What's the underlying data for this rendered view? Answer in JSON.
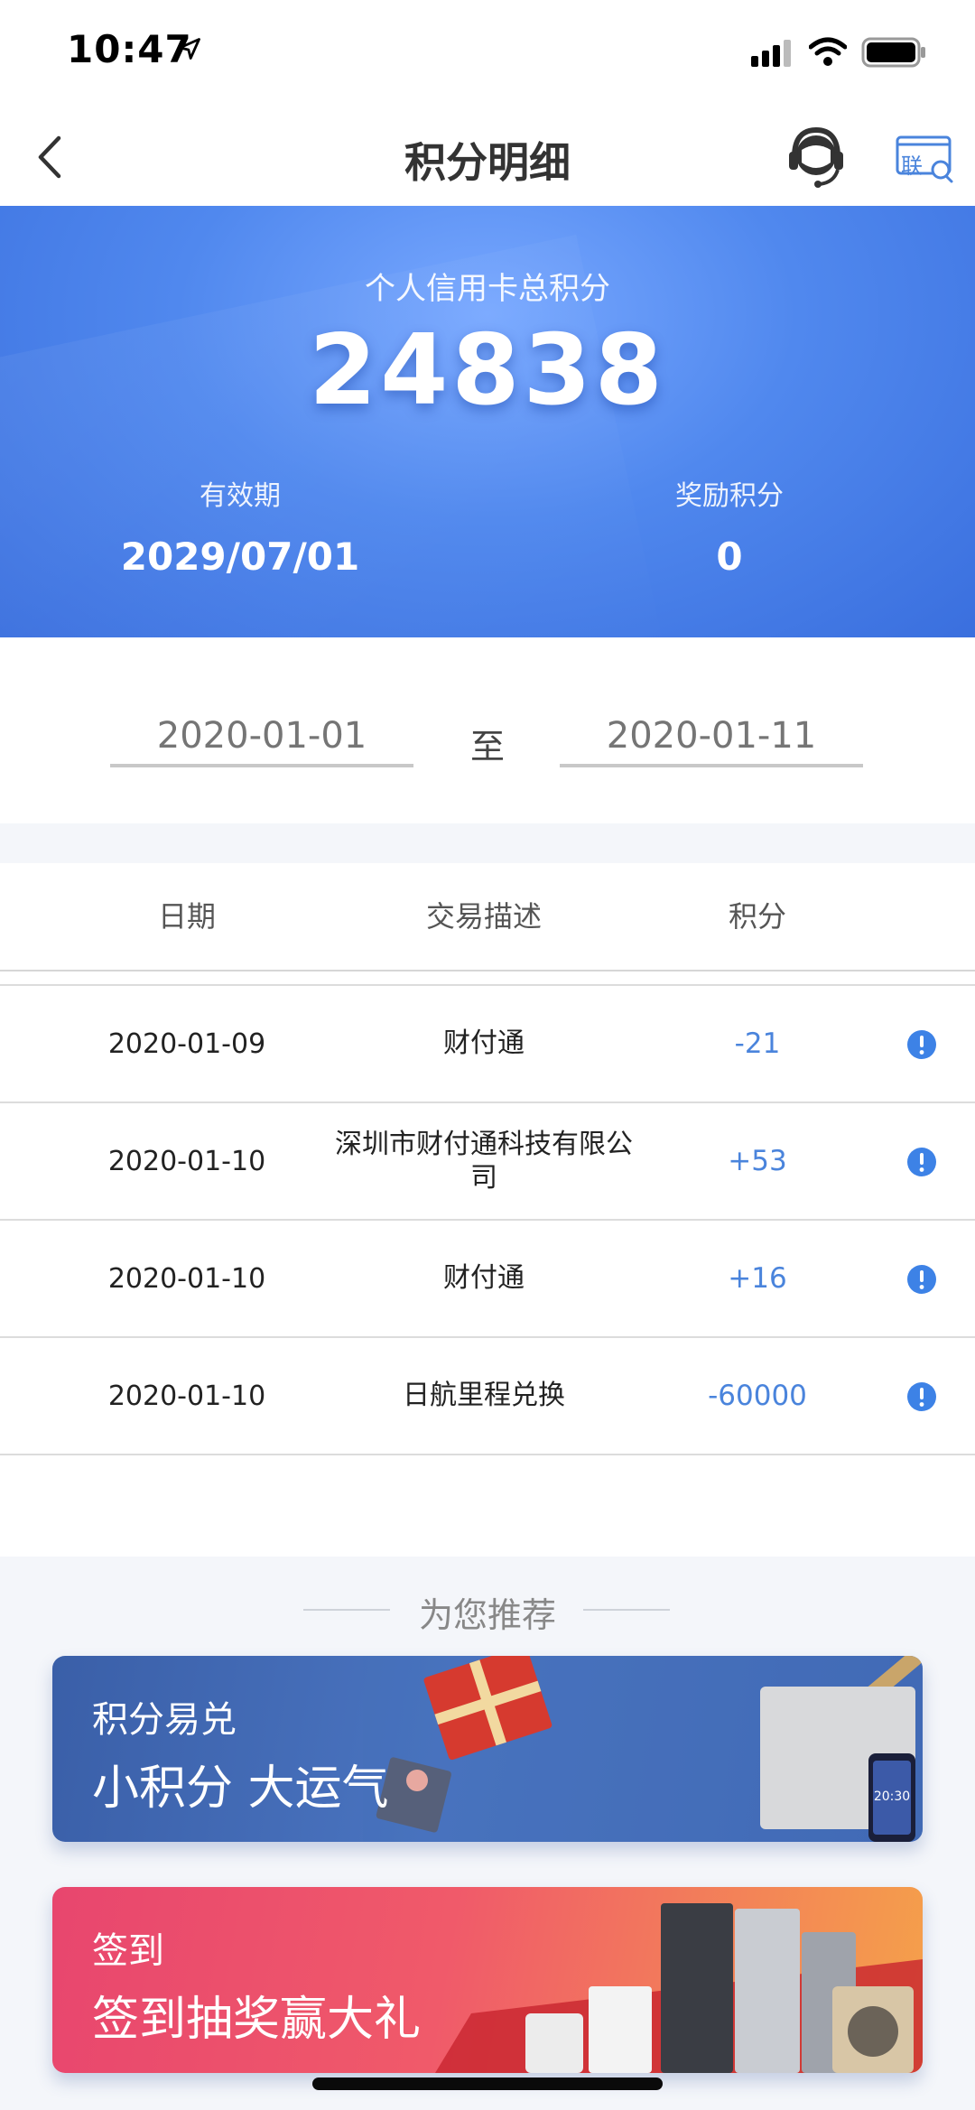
{
  "status_bar": {
    "time": "10:47",
    "icons": [
      "location-arrow-icon",
      "cellular-signal-icon",
      "wifi-icon",
      "battery-icon"
    ]
  },
  "nav": {
    "title": "积分明细",
    "back_icon": "chevron-left-icon",
    "customer_service_icon": "headset-icon",
    "unionpay_label": "联"
  },
  "summary": {
    "total_label": "个人信用卡总积分",
    "total_points": "24838",
    "expiry_label": "有效期",
    "expiry_value": "2029/07/01",
    "bonus_label": "奖励积分",
    "bonus_value": "0"
  },
  "date_range": {
    "from_placeholder": "2020-01-01",
    "separator": "至",
    "to_placeholder": "2020-01-11"
  },
  "table": {
    "headers": {
      "date": "日期",
      "desc": "交易描述",
      "points": "积分"
    },
    "rows": [
      {
        "date": "2020-01-09",
        "desc": "财付通",
        "points": "-21"
      },
      {
        "date": "2020-01-10",
        "desc": "深圳市财付通科技有限公司",
        "points": "+53"
      },
      {
        "date": "2020-01-10",
        "desc": "财付通",
        "points": "+16"
      },
      {
        "date": "2020-01-10",
        "desc": "日航里程兑换",
        "points": "-60000"
      }
    ]
  },
  "recommend": {
    "title": "为您推荐",
    "banners": [
      {
        "sub": "积分易兑",
        "main": "小积分 大运气",
        "phone_time": "20:30"
      },
      {
        "sub": "签到",
        "main": "签到抽奖赢大礼"
      }
    ]
  },
  "colors": {
    "accent": "#4a84dc",
    "hero_blue": "#5088ee",
    "background_band": "#f4f6fa"
  }
}
